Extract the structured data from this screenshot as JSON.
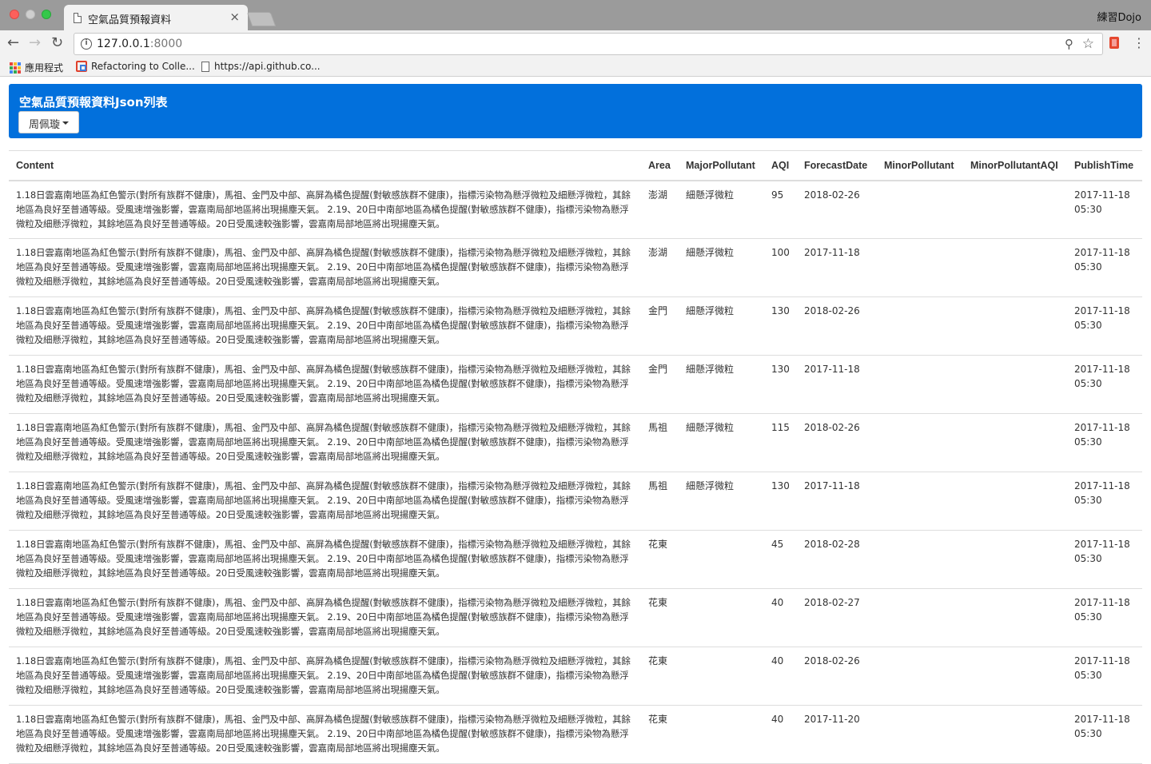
{
  "browser": {
    "tab_title": "空氣品質預報資料",
    "tab_close": "×",
    "profile": "練習Dojo",
    "url_host": "127.0.0.1",
    "url_port": ":8000",
    "bookmarks": [
      {
        "label": "應用程式",
        "icon": "apps-grid-icon"
      },
      {
        "label": "Refactoring to Colle...",
        "icon": "favicon-icon"
      },
      {
        "label": "https://api.github.co...",
        "icon": "page-icon"
      }
    ]
  },
  "header": {
    "title": "空氣品質預報資料Json列表",
    "user": "周佩璇"
  },
  "table": {
    "columns": [
      "Content",
      "Area",
      "MajorPollutant",
      "AQI",
      "ForecastDate",
      "MinorPollutant",
      "MinorPollutantAQI",
      "PublishTime"
    ],
    "rows": [
      {
        "content": "1.18日雲嘉南地區為紅色警示(對所有族群不健康)，馬祖、金門及中部、高屏為橘色提醒(對敏感族群不健康)，指標污染物為懸浮微粒及細懸浮微粒，其餘地區為良好至普通等級。受風速增強影響，雲嘉南局部地區將出現揚塵天氣。 2.19、20日中南部地區為橘色提醒(對敏感族群不健康)，指標污染物為懸浮微粒及細懸浮微粒，其餘地區為良好至普通等級。20日受風速較強影響，雲嘉南局部地區將出現揚塵天氣。",
        "area": "澎湖",
        "major": "細懸浮微粒",
        "aqi": "95",
        "forecast": "2018-02-26",
        "minor": "",
        "minor_aqi": "",
        "publish": "2017-11-18 05:30"
      },
      {
        "content": "1.18日雲嘉南地區為紅色警示(對所有族群不健康)，馬祖、金門及中部、高屏為橘色提醒(對敏感族群不健康)，指標污染物為懸浮微粒及細懸浮微粒，其餘地區為良好至普通等級。受風速增強影響，雲嘉南局部地區將出現揚塵天氣。 2.19、20日中南部地區為橘色提醒(對敏感族群不健康)，指標污染物為懸浮微粒及細懸浮微粒，其餘地區為良好至普通等級。20日受風速較強影響，雲嘉南局部地區將出現揚塵天氣。",
        "area": "澎湖",
        "major": "細懸浮微粒",
        "aqi": "100",
        "forecast": "2017-11-18",
        "minor": "",
        "minor_aqi": "",
        "publish": "2017-11-18 05:30"
      },
      {
        "content": "1.18日雲嘉南地區為紅色警示(對所有族群不健康)，馬祖、金門及中部、高屏為橘色提醒(對敏感族群不健康)，指標污染物為懸浮微粒及細懸浮微粒，其餘地區為良好至普通等級。受風速增強影響，雲嘉南局部地區將出現揚塵天氣。 2.19、20日中南部地區為橘色提醒(對敏感族群不健康)，指標污染物為懸浮微粒及細懸浮微粒，其餘地區為良好至普通等級。20日受風速較強影響，雲嘉南局部地區將出現揚塵天氣。",
        "area": "金門",
        "major": "細懸浮微粒",
        "aqi": "130",
        "forecast": "2018-02-26",
        "minor": "",
        "minor_aqi": "",
        "publish": "2017-11-18 05:30"
      },
      {
        "content": "1.18日雲嘉南地區為紅色警示(對所有族群不健康)，馬祖、金門及中部、高屏為橘色提醒(對敏感族群不健康)，指標污染物為懸浮微粒及細懸浮微粒，其餘地區為良好至普通等級。受風速增強影響，雲嘉南局部地區將出現揚塵天氣。 2.19、20日中南部地區為橘色提醒(對敏感族群不健康)，指標污染物為懸浮微粒及細懸浮微粒，其餘地區為良好至普通等級。20日受風速較強影響，雲嘉南局部地區將出現揚塵天氣。",
        "area": "金門",
        "major": "細懸浮微粒",
        "aqi": "130",
        "forecast": "2017-11-18",
        "minor": "",
        "minor_aqi": "",
        "publish": "2017-11-18 05:30"
      },
      {
        "content": "1.18日雲嘉南地區為紅色警示(對所有族群不健康)，馬祖、金門及中部、高屏為橘色提醒(對敏感族群不健康)，指標污染物為懸浮微粒及細懸浮微粒，其餘地區為良好至普通等級。受風速增強影響，雲嘉南局部地區將出現揚塵天氣。 2.19、20日中南部地區為橘色提醒(對敏感族群不健康)，指標污染物為懸浮微粒及細懸浮微粒，其餘地區為良好至普通等級。20日受風速較強影響，雲嘉南局部地區將出現揚塵天氣。",
        "area": "馬祖",
        "major": "細懸浮微粒",
        "aqi": "115",
        "forecast": "2018-02-26",
        "minor": "",
        "minor_aqi": "",
        "publish": "2017-11-18 05:30"
      },
      {
        "content": "1.18日雲嘉南地區為紅色警示(對所有族群不健康)，馬祖、金門及中部、高屏為橘色提醒(對敏感族群不健康)，指標污染物為懸浮微粒及細懸浮微粒，其餘地區為良好至普通等級。受風速增強影響，雲嘉南局部地區將出現揚塵天氣。 2.19、20日中南部地區為橘色提醒(對敏感族群不健康)，指標污染物為懸浮微粒及細懸浮微粒，其餘地區為良好至普通等級。20日受風速較強影響，雲嘉南局部地區將出現揚塵天氣。",
        "area": "馬祖",
        "major": "細懸浮微粒",
        "aqi": "130",
        "forecast": "2017-11-18",
        "minor": "",
        "minor_aqi": "",
        "publish": "2017-11-18 05:30"
      },
      {
        "content": "1.18日雲嘉南地區為紅色警示(對所有族群不健康)，馬祖、金門及中部、高屏為橘色提醒(對敏感族群不健康)，指標污染物為懸浮微粒及細懸浮微粒，其餘地區為良好至普通等級。受風速增強影響，雲嘉南局部地區將出現揚塵天氣。 2.19、20日中南部地區為橘色提醒(對敏感族群不健康)，指標污染物為懸浮微粒及細懸浮微粒，其餘地區為良好至普通等級。20日受風速較強影響，雲嘉南局部地區將出現揚塵天氣。",
        "area": "花東",
        "major": "",
        "aqi": "45",
        "forecast": "2018-02-28",
        "minor": "",
        "minor_aqi": "",
        "publish": "2017-11-18 05:30"
      },
      {
        "content": "1.18日雲嘉南地區為紅色警示(對所有族群不健康)，馬祖、金門及中部、高屏為橘色提醒(對敏感族群不健康)，指標污染物為懸浮微粒及細懸浮微粒，其餘地區為良好至普通等級。受風速增強影響，雲嘉南局部地區將出現揚塵天氣。 2.19、20日中南部地區為橘色提醒(對敏感族群不健康)，指標污染物為懸浮微粒及細懸浮微粒，其餘地區為良好至普通等級。20日受風速較強影響，雲嘉南局部地區將出現揚塵天氣。",
        "area": "花東",
        "major": "",
        "aqi": "40",
        "forecast": "2018-02-27",
        "minor": "",
        "minor_aqi": "",
        "publish": "2017-11-18 05:30"
      },
      {
        "content": "1.18日雲嘉南地區為紅色警示(對所有族群不健康)，馬祖、金門及中部、高屏為橘色提醒(對敏感族群不健康)，指標污染物為懸浮微粒及細懸浮微粒，其餘地區為良好至普通等級。受風速增強影響，雲嘉南局部地區將出現揚塵天氣。 2.19、20日中南部地區為橘色提醒(對敏感族群不健康)，指標污染物為懸浮微粒及細懸浮微粒，其餘地區為良好至普通等級。20日受風速較強影響，雲嘉南局部地區將出現揚塵天氣。",
        "area": "花東",
        "major": "",
        "aqi": "40",
        "forecast": "2018-02-26",
        "minor": "",
        "minor_aqi": "",
        "publish": "2017-11-18 05:30"
      },
      {
        "content": "1.18日雲嘉南地區為紅色警示(對所有族群不健康)，馬祖、金門及中部、高屏為橘色提醒(對敏感族群不健康)，指標污染物為懸浮微粒及細懸浮微粒，其餘地區為良好至普通等級。受風速增強影響，雲嘉南局部地區將出現揚塵天氣。 2.19、20日中南部地區為橘色提醒(對敏感族群不健康)，指標污染物為懸浮微粒及細懸浮微粒，其餘地區為良好至普通等級。20日受風速較強影響，雲嘉南局部地區將出現揚塵天氣。",
        "area": "花東",
        "major": "",
        "aqi": "40",
        "forecast": "2017-11-20",
        "minor": "",
        "minor_aqi": "",
        "publish": "2017-11-18 05:30"
      }
    ]
  },
  "colors": {
    "header_bg": "#0270dc",
    "apps_grid": [
      "#e8453c",
      "#f9bb2d",
      "#4285f4",
      "#34a853",
      "#e8453c",
      "#f9bb2d",
      "#4285f4",
      "#34a853",
      "#e8453c"
    ]
  }
}
